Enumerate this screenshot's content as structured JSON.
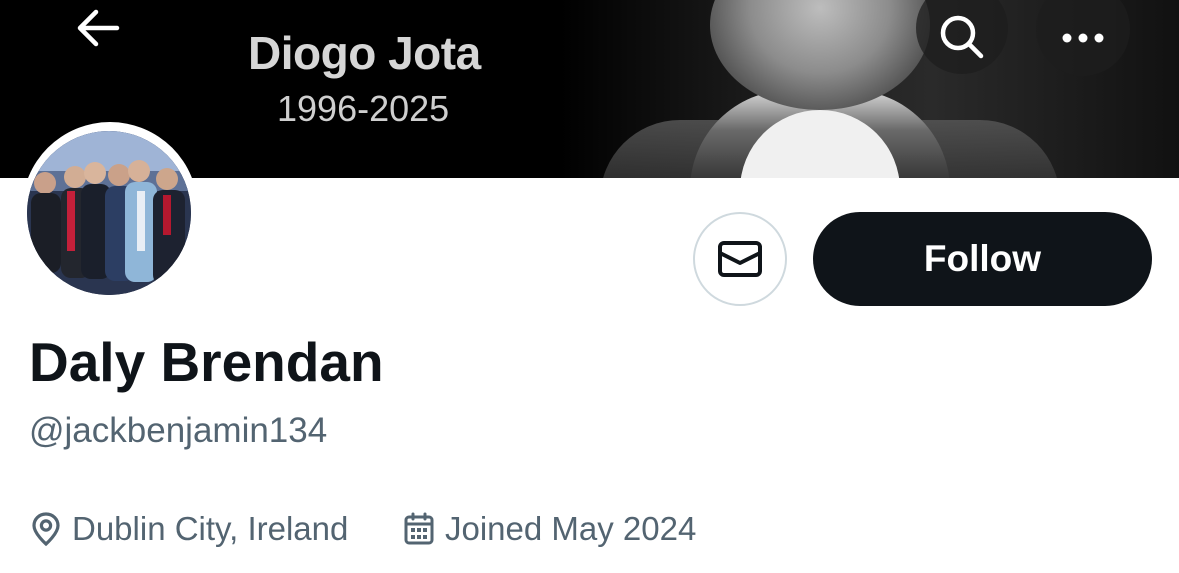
{
  "banner": {
    "title": "Diogo Jota",
    "subtitle": "1996-2025"
  },
  "header": {
    "back_icon": "arrow-left-icon",
    "search_icon": "search-icon",
    "more_icon": "more-horizontal-icon"
  },
  "profile": {
    "display_name": "Daly Brendan",
    "handle": "@jackbenjamin134",
    "location": "Dublin City, Ireland",
    "joined": "Joined May 2024"
  },
  "actions": {
    "message_icon": "envelope-icon",
    "follow_label": "Follow"
  },
  "colors": {
    "primary_text": "#0f1419",
    "secondary_text": "#536471",
    "follow_bg": "#0f1419",
    "border": "#cfd9de"
  }
}
